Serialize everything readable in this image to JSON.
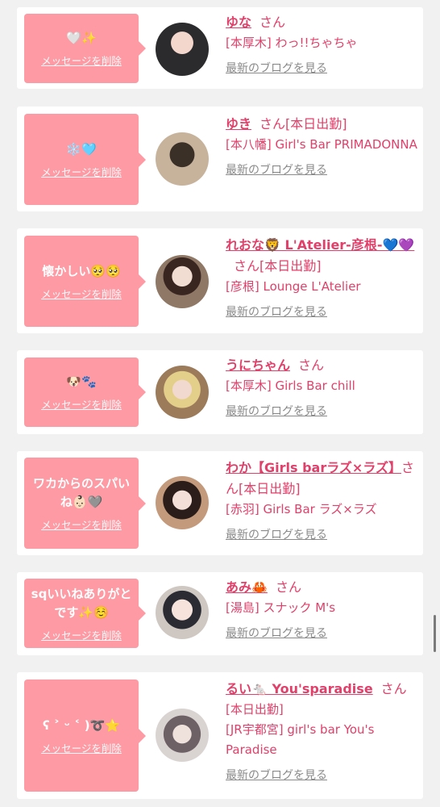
{
  "delete_label": "メッセージを削除",
  "blog_label": "最新のブログを見る",
  "san": "さん",
  "accent_color": "#fd9aa3",
  "name_color": "#e0406a",
  "cards": [
    {
      "message": "🤍✨",
      "name": "ゆな",
      "status": "",
      "shop": "[本厚木] わっ!!ちゃちゃ"
    },
    {
      "message": "❄️🩵",
      "name": "ゆき",
      "status": "[本日出勤]",
      "shop": "[本八幡] Girl's Bar PRIMADONNA"
    },
    {
      "message": "懐かしい🥺🥺",
      "name": "れおな🦁 L'Atelier-彦根-💙💜",
      "status": "[本日出勤]",
      "shop": "[彦根] Lounge L'Atelier"
    },
    {
      "message": "🐶🐾",
      "name": "うにちゃん",
      "status": "",
      "shop": "[本厚木] Girls Bar chill"
    },
    {
      "message": "ワカからのスパいね👶🏻🩶",
      "name": "わか【Girls barラズ×ラズ】",
      "status": "[本日出勤]",
      "shop": "[赤羽] Girls Bar ラズ×ラズ"
    },
    {
      "message": "sqいいねありがとです✨☺️",
      "name": "あみ🦀",
      "status": "",
      "shop": "[湯島] スナック M's"
    },
    {
      "message": "ʕ ˃ ᵕ ˂ )➰⭐️",
      "name": "るい🐁 You'sparadise",
      "status": "[本日出勤]",
      "shop": "[JR宇都宮] girl's bar You's Paradise"
    }
  ]
}
